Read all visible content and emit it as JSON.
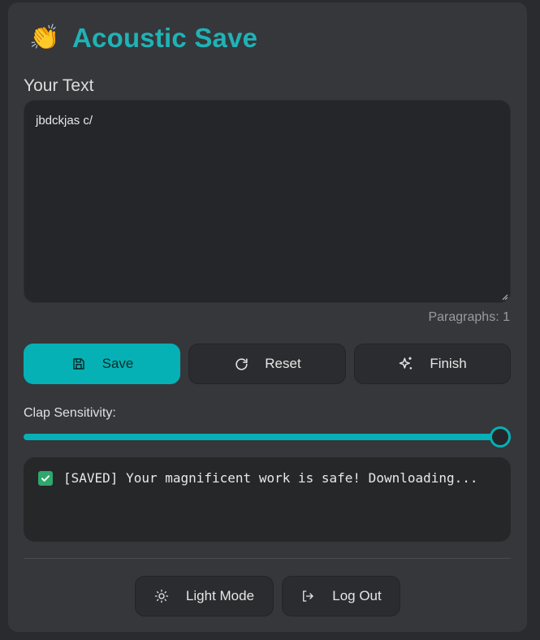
{
  "header": {
    "emoji": "👏",
    "title": "Acoustic Save"
  },
  "editor": {
    "label": "Your Text",
    "value": "jbdckjas c/",
    "paragraphs_label": "Paragraphs: 1"
  },
  "actions": {
    "save_label": "Save",
    "reset_label": "Reset",
    "finish_label": "Finish"
  },
  "sensitivity": {
    "label": "Clap Sensitivity:",
    "level": 1.0
  },
  "status": {
    "message": "[SAVED] Your magnificent work is safe! Downloading..."
  },
  "footer": {
    "light_mode_label": "Light Mode",
    "logout_label": "Log Out"
  },
  "colors": {
    "accent": "#05b1b4",
    "title": "#1fb3b6",
    "card": "#36373b",
    "success": "#2ea86c"
  },
  "icons": [
    "clapping-hands-icon",
    "save-icon",
    "refresh-icon",
    "sparkles-icon",
    "checkmark-icon",
    "sun-icon",
    "logout-icon"
  ]
}
